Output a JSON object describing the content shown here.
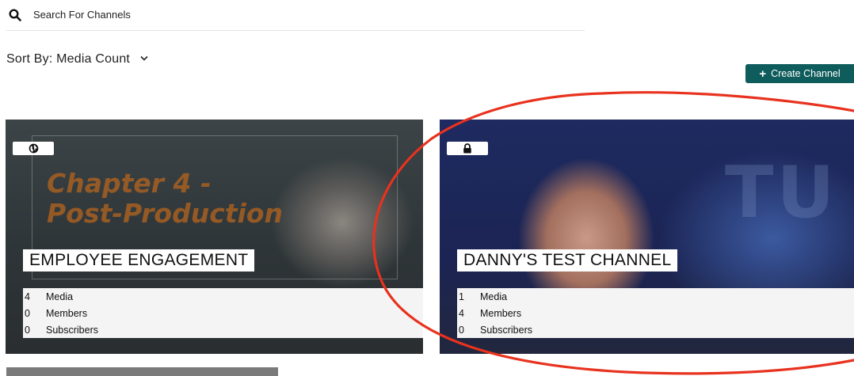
{
  "search": {
    "placeholder": "Search For Channels",
    "value": ""
  },
  "sort": {
    "label": "Sort By: Media Count"
  },
  "create_button": {
    "label": "Create Channel"
  },
  "channels": [
    {
      "title": "EMPLOYEE ENGAGEMENT",
      "privacy_icon": "globe-icon",
      "thumbnail_text": "Chapter 4 -\nPost-Production",
      "stats": [
        {
          "count": "4",
          "label": "Media"
        },
        {
          "count": "0",
          "label": "Members"
        },
        {
          "count": "0",
          "label": "Subscribers"
        }
      ]
    },
    {
      "title": "DANNY'S TEST CHANNEL",
      "privacy_icon": "lock-icon",
      "stats": [
        {
          "count": "1",
          "label": "Media"
        },
        {
          "count": "4",
          "label": "Members"
        },
        {
          "count": "0",
          "label": "Subscribers"
        }
      ]
    }
  ],
  "colors": {
    "accent": "#0f5c5c",
    "annotation": "#e8321e"
  }
}
